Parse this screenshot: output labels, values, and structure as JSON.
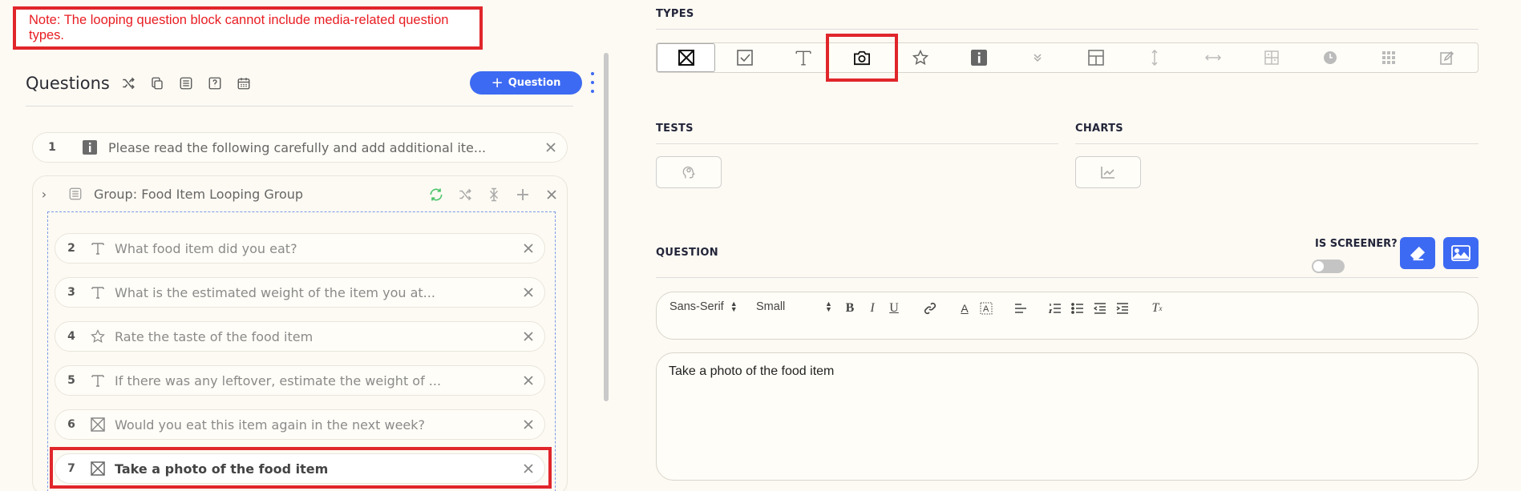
{
  "note": {
    "text": "Note: The looping question block cannot include media-related question types."
  },
  "questions_header": {
    "title": "Questions",
    "add_button_label": "Question",
    "add_button_plus": "+",
    "icons": [
      "shuffle-icon",
      "copy-icon",
      "list-icon",
      "help-icon",
      "calendar-icon"
    ]
  },
  "rows": [
    {
      "num": "1",
      "icon": "info-icon",
      "text": "Please read the following carefully and add additional ite..."
    }
  ],
  "group": {
    "chevron": "›",
    "text": "Group: Food Item Looping Group",
    "actions": [
      "loop-icon",
      "shuffle-icon",
      "shuffle-off-icon",
      "plus-icon",
      "close-icon"
    ],
    "items": [
      {
        "num": "2",
        "icon": "text-icon",
        "text": "What food item did you eat?"
      },
      {
        "num": "3",
        "icon": "text-icon",
        "text": "What is the estimated weight of the item you at..."
      },
      {
        "num": "4",
        "icon": "star-icon",
        "text": "Rate the taste of the food item"
      },
      {
        "num": "5",
        "icon": "text-icon",
        "text": "If there was any leftover, estimate the weight of ..."
      },
      {
        "num": "6",
        "icon": "multiple-choice-icon",
        "text": "Would you eat this item again in the next week?"
      },
      {
        "num": "7",
        "icon": "multiple-choice-icon",
        "text": "Take a photo of the food item"
      }
    ]
  },
  "types_section": {
    "label": "TYPES",
    "buttons": [
      {
        "name": "multiple-choice",
        "selected": true
      },
      {
        "name": "checkbox"
      },
      {
        "name": "text"
      },
      {
        "name": "camera"
      },
      {
        "name": "star"
      },
      {
        "name": "info"
      },
      {
        "name": "dropdown"
      },
      {
        "name": "layout"
      },
      {
        "name": "vertical-slider"
      },
      {
        "name": "horizontal-slider"
      },
      {
        "name": "ranking"
      },
      {
        "name": "clock"
      },
      {
        "name": "grid"
      },
      {
        "name": "note"
      }
    ]
  },
  "tests_section": {
    "label": "TESTS"
  },
  "charts_section": {
    "label": "CHARTS"
  },
  "question_section": {
    "label": "QUESTION",
    "screener_label": "IS SCREENER?",
    "font_family": "Sans-Serif",
    "font_size": "Small",
    "editor_text": "Take a photo of the food item"
  },
  "colors": {
    "accent": "#3d6af2",
    "highlight": "#e0262b",
    "note_text": "#e81c22",
    "background": "#fdfaf3"
  }
}
